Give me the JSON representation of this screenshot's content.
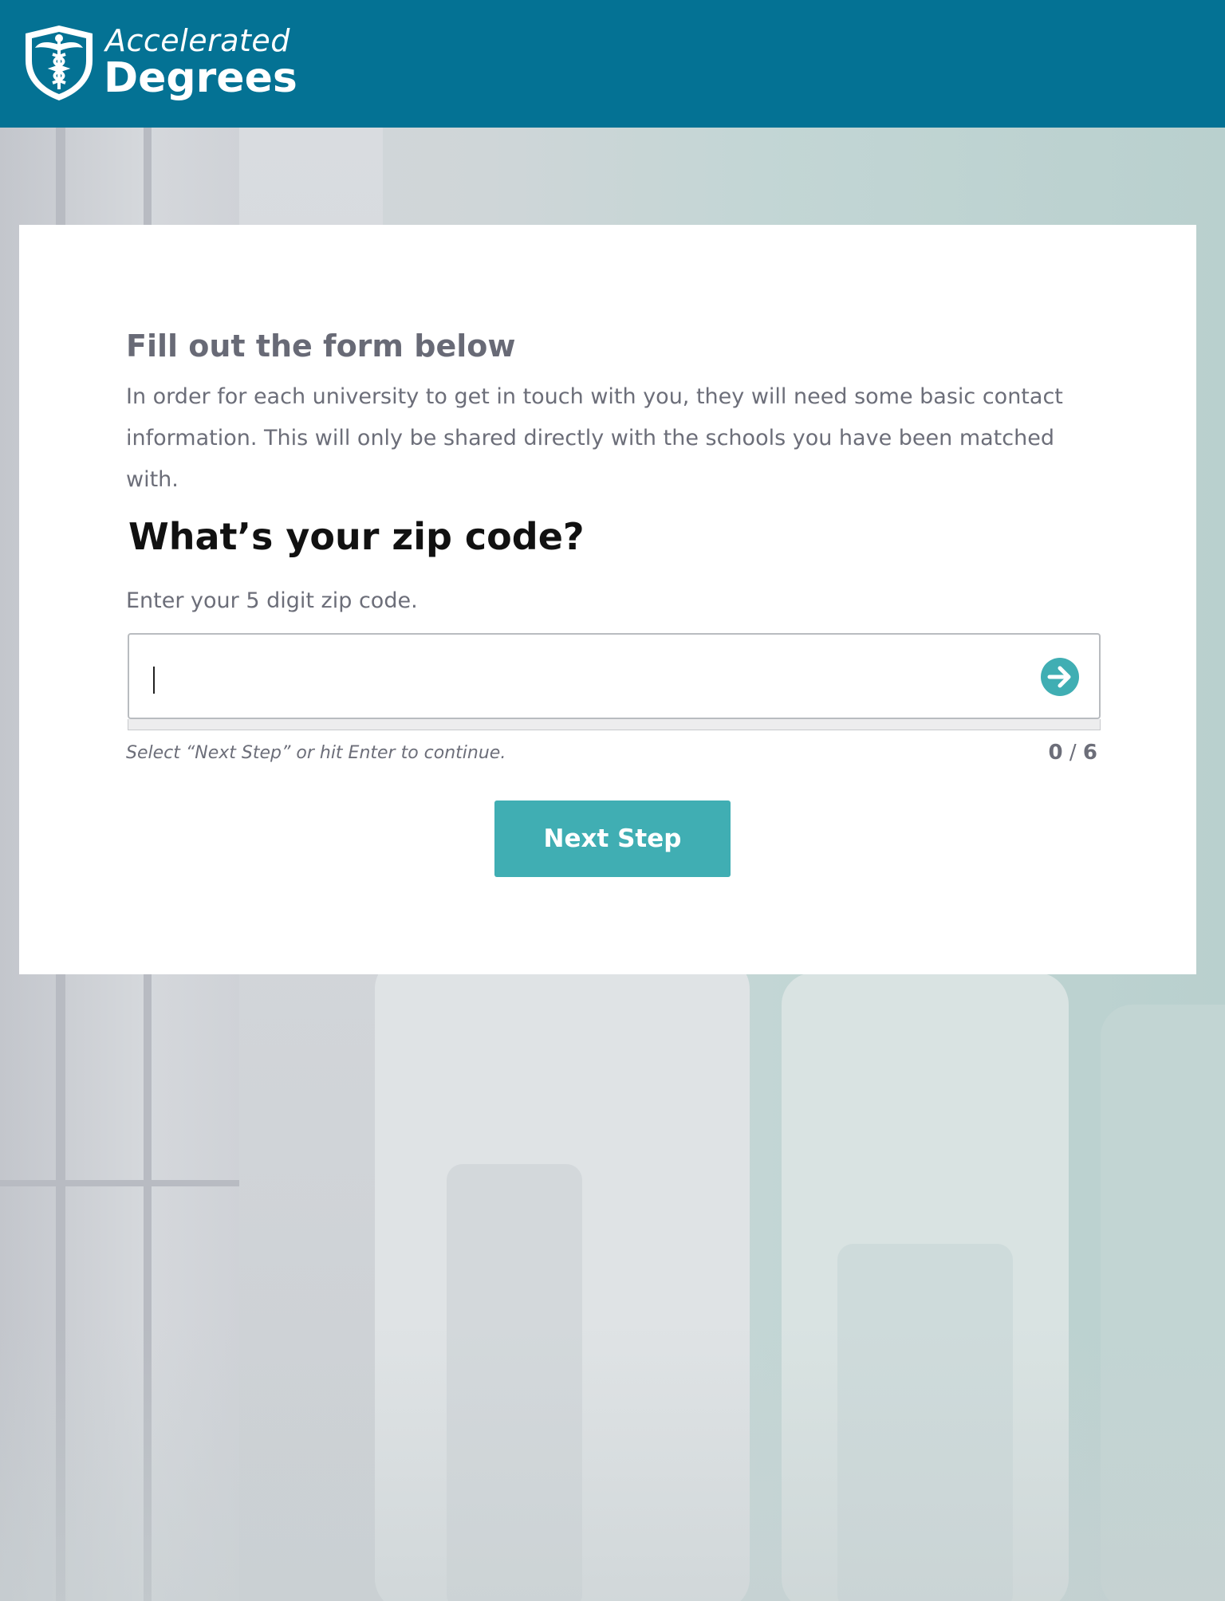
{
  "header": {
    "brand_top": "Accelerated",
    "brand_bottom": "Degrees",
    "logo_icon": "caduceus-shield-icon",
    "background_color": "#047294"
  },
  "form": {
    "heading": "Fill out the form below",
    "intro": "In order for each university to get in touch with you, they will need some basic contact information. This will only be shared directly with the schools you have been matched with.",
    "question": "What’s your zip code?",
    "hint": "Enter your 5 digit zip code.",
    "zip_value": "",
    "submit_icon": "arrow-right-circle-icon",
    "continue_note": "Select “Next Step” or hit Enter to continue.",
    "progress_current": "0",
    "progress_separator": "/",
    "progress_total": "6",
    "next_button_label": "Next Step"
  },
  "colors": {
    "accent": "#40aeb3",
    "header": "#047294",
    "text_muted": "#6c6e79"
  }
}
